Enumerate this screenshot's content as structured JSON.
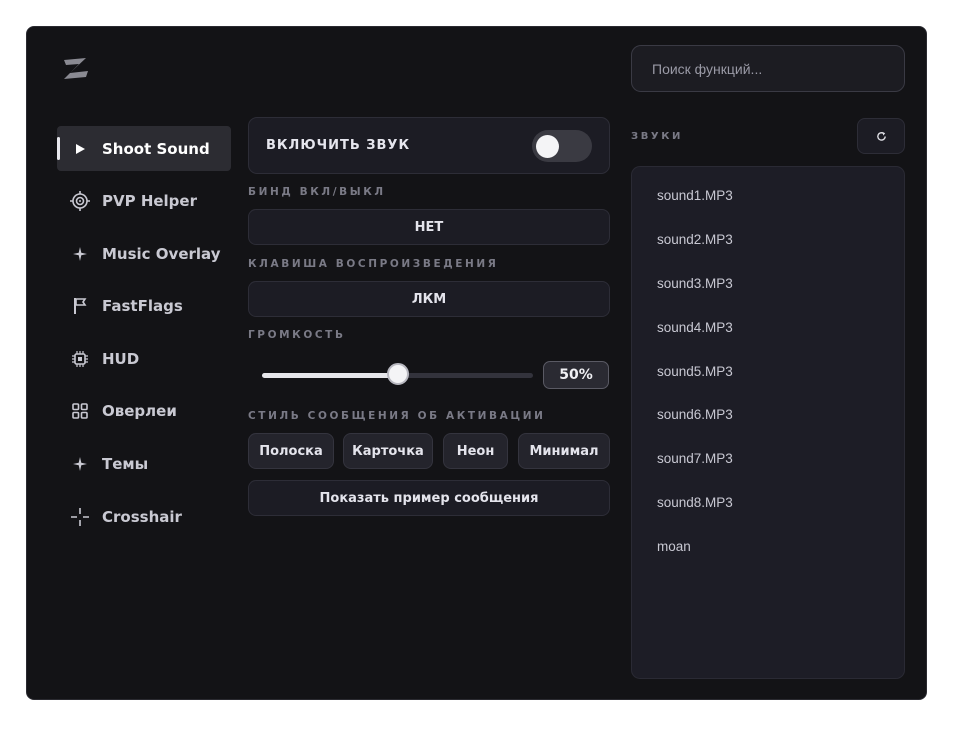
{
  "app": {
    "logo": "Z"
  },
  "search": {
    "placeholder": "Поиск функций..."
  },
  "sidebar": {
    "items": [
      {
        "label": "Shoot Sound",
        "icon": "play-icon",
        "active": true
      },
      {
        "label": "PVP Helper",
        "icon": "target-icon"
      },
      {
        "label": "Music Overlay",
        "icon": "sparkle-icon"
      },
      {
        "label": "FastFlags",
        "icon": "flag-icon"
      },
      {
        "label": "HUD",
        "icon": "chip-icon"
      },
      {
        "label": "Оверлеи",
        "icon": "grid-icon"
      },
      {
        "label": "Темы",
        "icon": "sparkle-icon"
      },
      {
        "label": "Crosshair",
        "icon": "crosshair-icon"
      }
    ]
  },
  "main": {
    "enable_sound": {
      "label": "ВКЛЮЧИТЬ ЗВУК",
      "on": false
    },
    "bind_label": "БИНД ВКЛ/ВЫКЛ",
    "bind_value": "НЕТ",
    "play_key_label": "КЛАВИША ВОСПРОИЗВЕДЕНИЯ",
    "play_key_value": "ЛКМ",
    "volume_label": "ГРОМКОСТЬ",
    "volume_value": 0.5,
    "volume_text": "50%",
    "style_label": "СТИЛЬ СООБЩЕНИЯ ОБ АКТИВАЦИИ",
    "styles": [
      "Полоска",
      "Карточка",
      "Неон",
      "Минимал"
    ],
    "preview_button": "Показать пример сообщения"
  },
  "sounds": {
    "label": "ЗВУКИ",
    "refresh_icon": "refresh-icon",
    "items": [
      "sound1.MP3",
      "sound2.MP3",
      "sound3.MP3",
      "sound4.MP3",
      "sound5.MP3",
      "sound6.MP3",
      "sound7.MP3",
      "sound8.MP3",
      "moan"
    ]
  }
}
